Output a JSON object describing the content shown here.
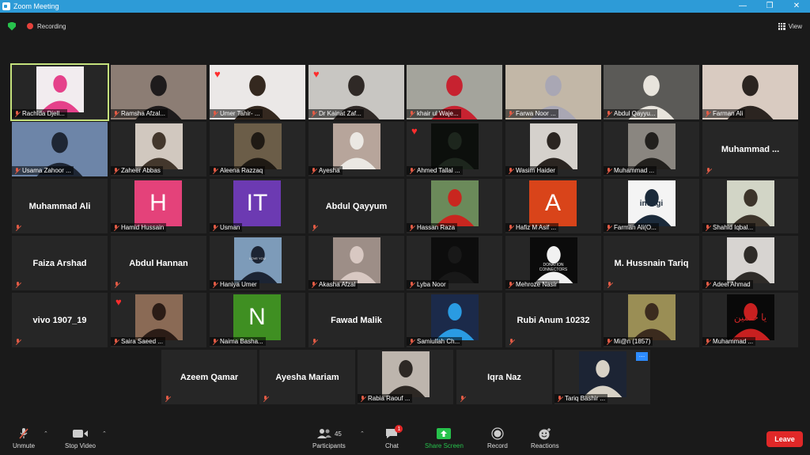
{
  "window": {
    "title": "Zoom Meeting"
  },
  "status": {
    "recording_label": "Recording",
    "view_label": "View"
  },
  "colors": {
    "titlebar": "#2d9bd7",
    "tile_bg": "#262626",
    "active_speaker": "#c4e07c",
    "leave": "#e02828",
    "share": "#27c24c",
    "mute_red": "#e25b45"
  },
  "participants": [
    {
      "name": "Rachida Djell...",
      "type": "video",
      "active": true,
      "bg": "#f2ecef",
      "fg": "#e5418a"
    },
    {
      "name": "Ramsha Afzal...",
      "type": "video",
      "bg": "#8c7d74",
      "fg": "#1e1b1c"
    },
    {
      "name": "Umer Tahir- ...",
      "type": "video",
      "heart": true,
      "bg": "#ebe8e7",
      "fg": "#34281f"
    },
    {
      "name": "Dr Kainat Zaf...",
      "type": "video",
      "heart": true,
      "bg": "#c8c6c2",
      "fg": "#2f2926"
    },
    {
      "name": "khair ul Waje...",
      "type": "video",
      "bg": "#a4a49c",
      "fg": "#c72230"
    },
    {
      "name": "Farwa Noor ...",
      "type": "video",
      "bg": "#c2b7a7",
      "fg": "#a9a7b4"
    },
    {
      "name": "Abdul Qayyu...",
      "type": "video",
      "bg": "#5b5a57",
      "fg": "#e8e4dc"
    },
    {
      "name": "Farman Ali",
      "type": "video",
      "bg": "#d9cbc1",
      "fg": "#2b2420"
    },
    {
      "name": "Usama Zahoor ...",
      "type": "video",
      "bg": "#6d85a8",
      "fg": "#1e2634"
    },
    {
      "name": "Zaheer Abbas",
      "type": "video",
      "bg": "#d1c8bf",
      "fg": "#43372c"
    },
    {
      "name": "Aleena Razzaq",
      "type": "video",
      "bg": "#6b5d48",
      "fg": "#1f1a14"
    },
    {
      "name": "Ayesha",
      "type": "video",
      "bg": "#b7a59b",
      "fg": "#ebe8e3"
    },
    {
      "name": "Ahmed Tallal ...",
      "type": "video",
      "heart": true,
      "bg": "#0c0f0c",
      "fg": "#1d261d"
    },
    {
      "name": "Wasim Haider",
      "type": "video",
      "bg": "#d5d1cc",
      "fg": "#2b2521"
    },
    {
      "name": "Muhammad ...",
      "type": "video",
      "bg": "#8a8680",
      "fg": "#22201d"
    },
    {
      "name": "Muhammad ...",
      "type": "name"
    },
    {
      "name": "Muhammad Ali",
      "type": "name"
    },
    {
      "name": "Hamid Hussain",
      "type": "letter",
      "letter": "H",
      "color": "#e4427a"
    },
    {
      "name": "Usman",
      "type": "letter",
      "letter": "IT",
      "color": "#6c3ab2"
    },
    {
      "name": "Abdul Qayyum",
      "type": "name"
    },
    {
      "name": "Hassan Raza",
      "type": "video",
      "bg": "#6b8a5a",
      "fg": "#c9261f"
    },
    {
      "name": "Hafiz M Asif ...",
      "type": "letter",
      "letter": "A",
      "color": "#d9441a"
    },
    {
      "name": "Farman Ali(O...",
      "type": "video",
      "bg": "#f4f4f4",
      "fg": "#1b2a3a"
    },
    {
      "name": "Shahid Iqbal...",
      "type": "video",
      "bg": "#d2d5c6",
      "fg": "#3c342a"
    },
    {
      "name": "Faiza Arshad",
      "type": "name"
    },
    {
      "name": "Abdul Hannan",
      "type": "name"
    },
    {
      "name": "Haniya Umer",
      "type": "video",
      "bg": "#7d9bb9",
      "fg": "#1c2433"
    },
    {
      "name": "Akasha Afzal",
      "type": "video",
      "bg": "#9d8e87",
      "fg": "#d8c8c2"
    },
    {
      "name": "Lyba Noor",
      "type": "video",
      "bg": "#0d0d0d",
      "fg": "#181818"
    },
    {
      "name": "Mehroze Nasir",
      "type": "video",
      "bg": "#0b0b0b",
      "fg": "#f1f1f1"
    },
    {
      "name": "M. Hussnain Tariq",
      "type": "name"
    },
    {
      "name": "Adeel Ahmad",
      "type": "video",
      "bg": "#d7d4d1",
      "fg": "#2e2b28"
    },
    {
      "name": "vivo 1907_19",
      "type": "name"
    },
    {
      "name": "Saira Saeed ...",
      "type": "video",
      "heart": true,
      "bg": "#8a6a55",
      "fg": "#2b1c16"
    },
    {
      "name": "Naima Basha...",
      "type": "letter",
      "letter": "N",
      "color": "#3f8f22"
    },
    {
      "name": "Fawad Malik",
      "type": "name"
    },
    {
      "name": "Samiullah Ch...",
      "type": "video",
      "bg": "#1b2a4a",
      "fg": "#2a9be2"
    },
    {
      "name": "Rubi Anum 10232",
      "type": "name"
    },
    {
      "name": "Mi@n (1857)",
      "type": "video",
      "bg": "#9a8e55",
      "fg": "#3b2b1e"
    },
    {
      "name": "Muhammad ...",
      "type": "video",
      "bg": "#090909",
      "fg": "#c82020",
      "caption": "یا حسین"
    },
    {
      "name": "Azeem Qamar",
      "type": "name"
    },
    {
      "name": "Ayesha Mariam",
      "type": "name"
    },
    {
      "name": "Rabia Raouf ...",
      "type": "video",
      "bg": "#bdb5ad",
      "fg": "#2d2824"
    },
    {
      "name": "Iqra Naz",
      "type": "name"
    },
    {
      "name": "Tariq Bashir ...",
      "type": "video",
      "dots": true,
      "bg": "#1c2434",
      "fg": "#d8d2c6"
    }
  ],
  "logos": {
    "indagi": "indagi",
    "donation_line1": "DONATION",
    "donation_line2": "CONNECTORS",
    "heart_tag": "LOVE YOU"
  },
  "toolbar": {
    "unmute": "Unmute",
    "stop_video": "Stop Video",
    "participants": "Participants",
    "participants_count": "45",
    "chat": "Chat",
    "chat_badge": "1",
    "share_screen": "Share Screen",
    "record": "Record",
    "reactions": "Reactions",
    "leave": "Leave"
  }
}
